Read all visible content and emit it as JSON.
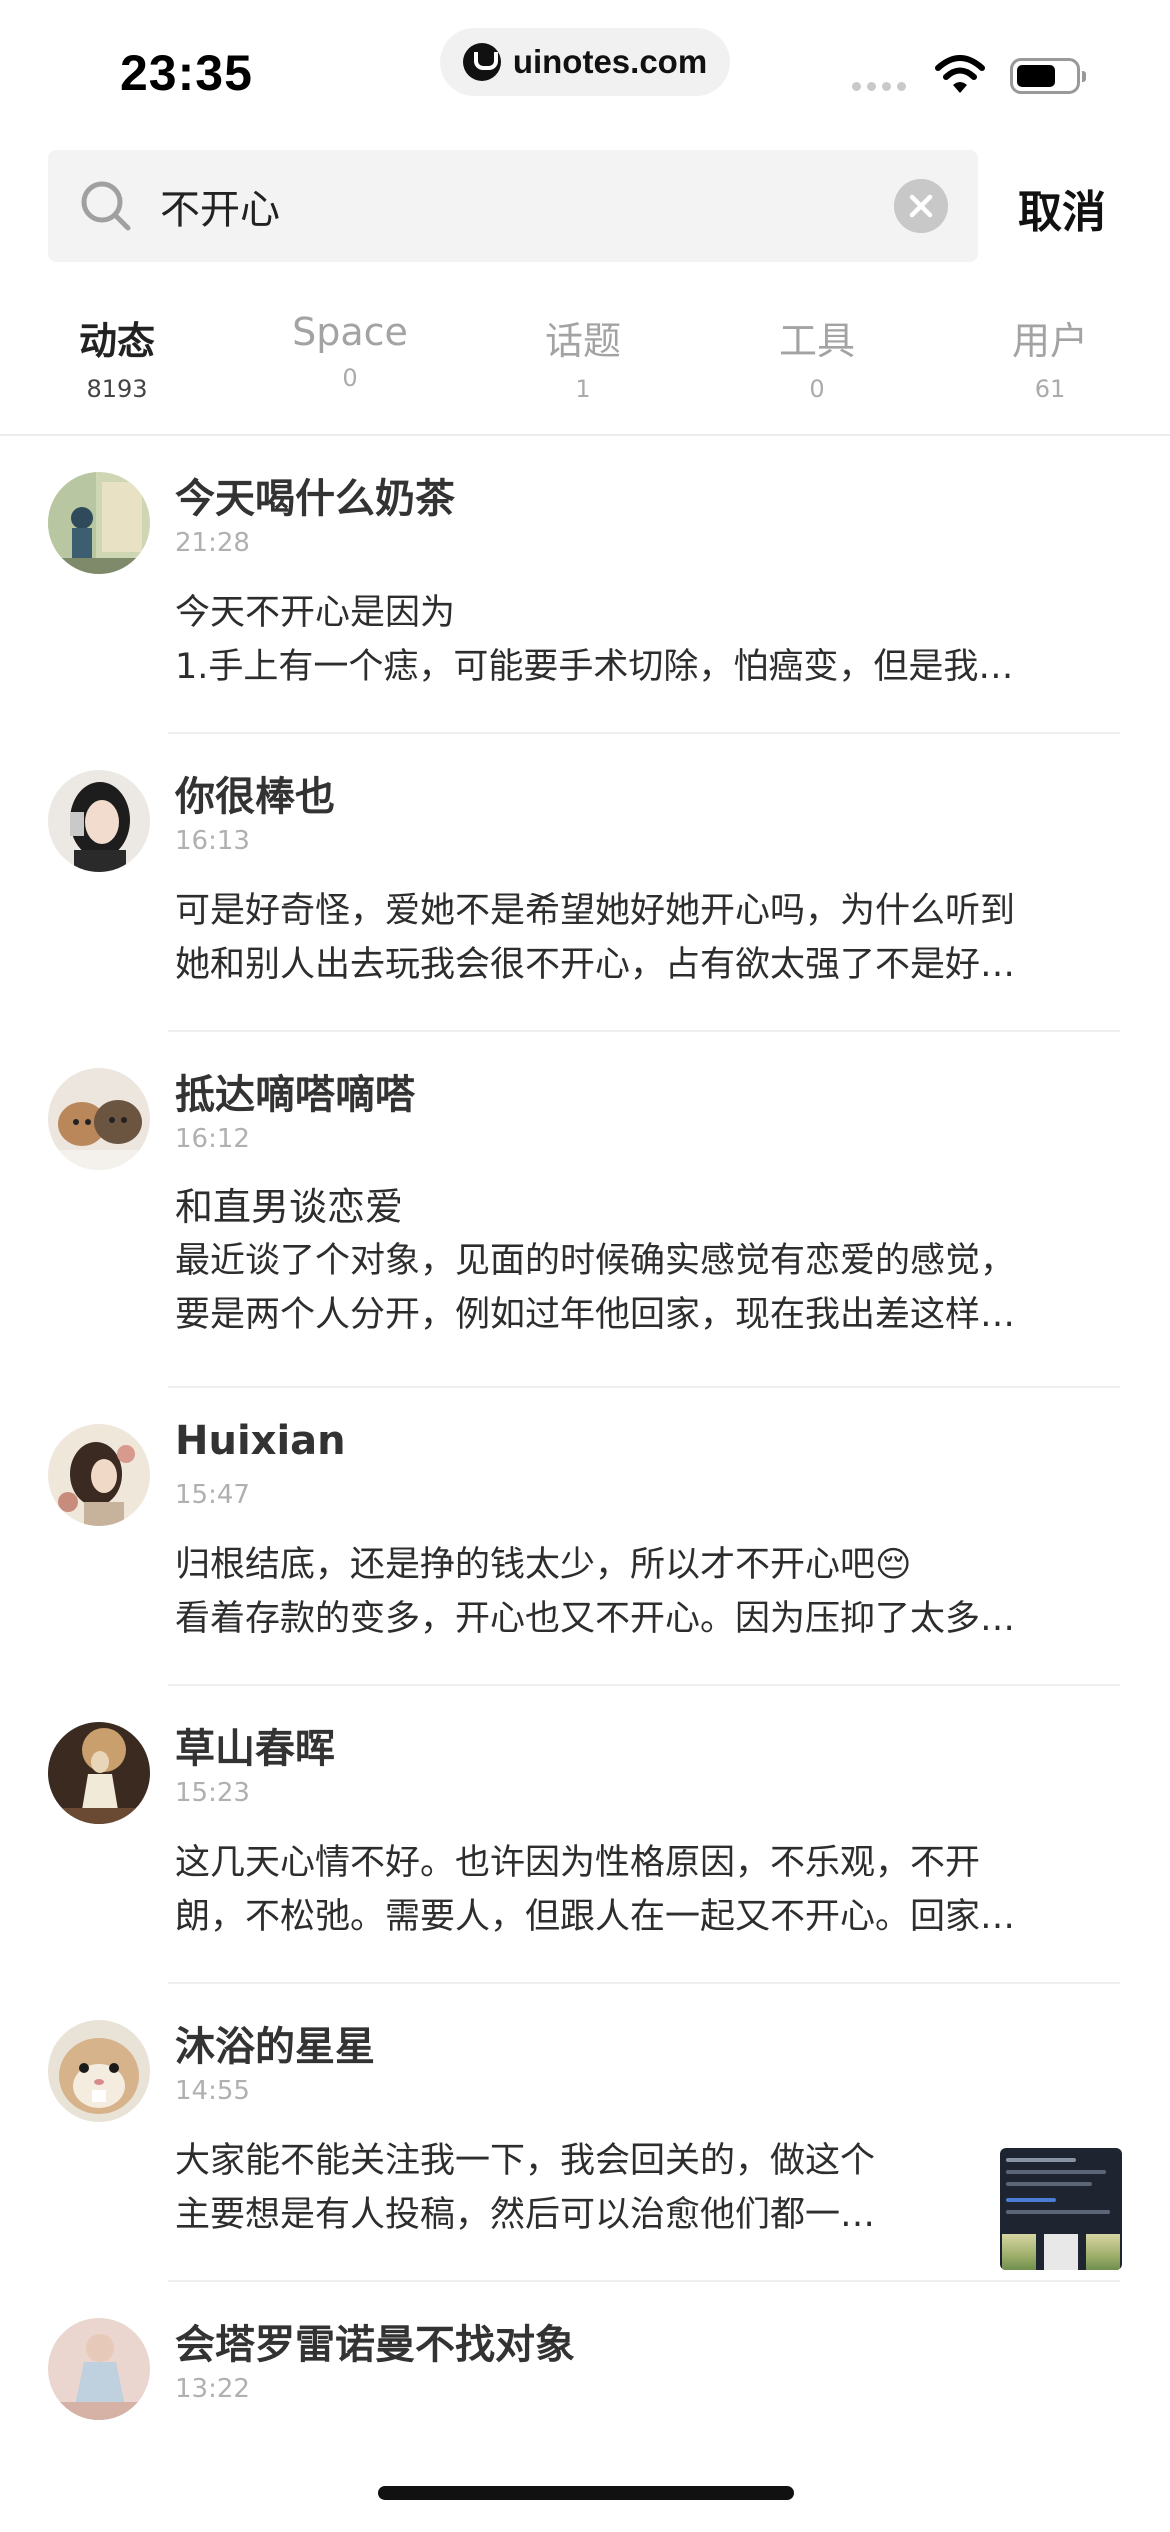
{
  "status_bar": {
    "time": "23:35",
    "url": "uinotes.com"
  },
  "search": {
    "value": "不开心",
    "cancel_label": "取消"
  },
  "tabs": [
    {
      "label": "动态",
      "count": "8193",
      "active": true
    },
    {
      "label": "Space",
      "count": "0",
      "active": false
    },
    {
      "label": "话题",
      "count": "1",
      "active": false
    },
    {
      "label": "工具",
      "count": "0",
      "active": false
    },
    {
      "label": "用户",
      "count": "61",
      "active": false
    }
  ],
  "posts": [
    {
      "name": "今天喝什么奶茶",
      "time": "21:28",
      "lines": [
        "今天不开心是因为",
        "1.手上有一个痣，可能要手术切除，怕癌变，但是我…"
      ]
    },
    {
      "name": "你很棒也",
      "time": "16:13",
      "lines": [
        "可是好奇怪，爱她不是希望她好她开心吗，为什么听到",
        "她和别人出去玩我会很不开心，占有欲太强了不是好…"
      ]
    },
    {
      "name": "抵达嘀嗒嘀嗒",
      "time": "16:12",
      "lines": [
        "和直男谈恋爱",
        "最近谈了个对象，见面的时候确实感觉有恋爱的感觉，",
        "要是两个人分开，例如过年他回家，现在我出差这样…"
      ]
    },
    {
      "name": "Huixian",
      "time": "15:47",
      "lines": [
        "归根结底，还是挣的钱太少，所以才不开心吧😔",
        "看着存款的变多，开心也又不开心。因为压抑了太多…"
      ]
    },
    {
      "name": "草山春晖",
      "time": "15:23",
      "lines": [
        "这几天心情不好。也许因为性格原因，不乐观，不开",
        "朗，不松弛。需要人，但跟人在一起又不开心。回家…"
      ]
    },
    {
      "name": "沐浴的星星",
      "time": "14:55",
      "lines": [
        "大家能不能关注我一下，我会回关的，做这个",
        "主要想是有人投稿，然后可以治愈他们都一…"
      ],
      "has_thumbnail": true
    },
    {
      "name": "会塔罗雷诺曼不找对象",
      "time": "13:22",
      "lines": []
    }
  ]
}
